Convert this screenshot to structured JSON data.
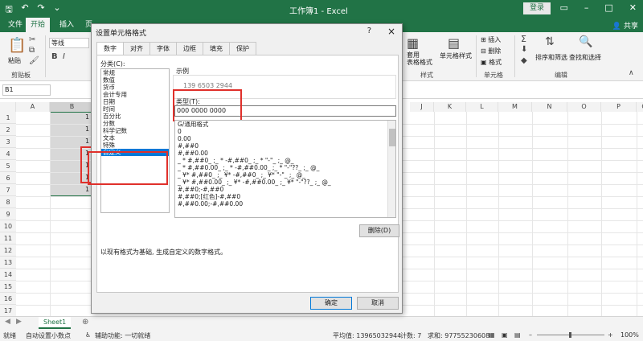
{
  "window": {
    "title": "工作簿1  -  Excel",
    "login": "登录",
    "share": "共享"
  },
  "ribbon_tabs": [
    "文件",
    "开始",
    "插入",
    "页"
  ],
  "ribbon": {
    "paste": "粘贴",
    "clipboard": "剪贴板",
    "font_name": "等线",
    "style_group": "样式",
    "cell_group": "单元格",
    "edit_group": "编辑",
    "format_table": "套用\n表格格式",
    "cell_style": "单元格样式",
    "insert": "插入",
    "delete": "删除",
    "format": "格式",
    "sort_filter": "排序和筛选",
    "find_select": "查找和选择"
  },
  "formula_bar": {
    "name_box": "B1"
  },
  "grid": {
    "columns": [
      "A",
      "B",
      "",
      "",
      "",
      "",
      "",
      "",
      "",
      "J",
      "K",
      "L",
      "M",
      "N",
      "O",
      "P",
      "Q"
    ],
    "rows": [
      "1",
      "2",
      "3",
      "4",
      "5",
      "6",
      "7",
      "8",
      "9",
      "10",
      "11",
      "12",
      "13",
      "14",
      "15",
      "16",
      "17"
    ],
    "values": [
      "1",
      "1",
      "1",
      "1",
      "1",
      "1",
      "1"
    ]
  },
  "sheet_tab": "Sheet1",
  "status": {
    "ready": "就绪",
    "auto_decimal": "自动设置小数点",
    "accessibility": "辅助功能: 一切就绪",
    "average": "平均值: 13965032944",
    "count": "计数: 7",
    "sum": "求和: 97755230608",
    "zoom": "100%"
  },
  "dialog": {
    "title": "设置单元格格式",
    "help": "?",
    "close": "×",
    "tabs": [
      "数字",
      "对齐",
      "字体",
      "边框",
      "填充",
      "保护"
    ],
    "category_label": "分类(C):",
    "categories": [
      "常规",
      "数值",
      "货币",
      "会计专用",
      "日期",
      "时间",
      "百分比",
      "分数",
      "科学记数",
      "文本",
      "特殊",
      "自定义"
    ],
    "selected_category": "自定义",
    "sample_label": "示例",
    "sample_value": "139 6503 2944",
    "type_label": "类型(T):",
    "type_value": "000 0000 0000",
    "formats": [
      "G/通用格式",
      "0",
      "0.00",
      "#,##0",
      "#,##0.00",
      "_ * #,##0_ ;_ * -#,##0_ ;_ * \"-\"_ ;_ @_",
      "_ * #,##0.00_ ;_ * -#,##0.00_ ;_ * \"-\"??_ ;_ @_",
      "_ ¥* #,##0_ ;_ ¥* -#,##0_ ;_ ¥* \"-\"_ ;_ @_",
      "_ ¥* #,##0.00_ ;_ ¥* -#,##0.00_ ;_ ¥* \"-\"??_ ;_ @_",
      "#,##0;-#,##0",
      "#,##0;[红色]-#,##0",
      "#,##0.00;-#,##0.00"
    ],
    "delete_btn": "删除(D)",
    "description": "以现有格式为基础, 生成自定义的数字格式。",
    "ok": "确定",
    "cancel": "取消"
  },
  "colors": {
    "excel_green": "#217346",
    "highlight_red": "#e0302b",
    "selection_blue": "#0078d7"
  }
}
